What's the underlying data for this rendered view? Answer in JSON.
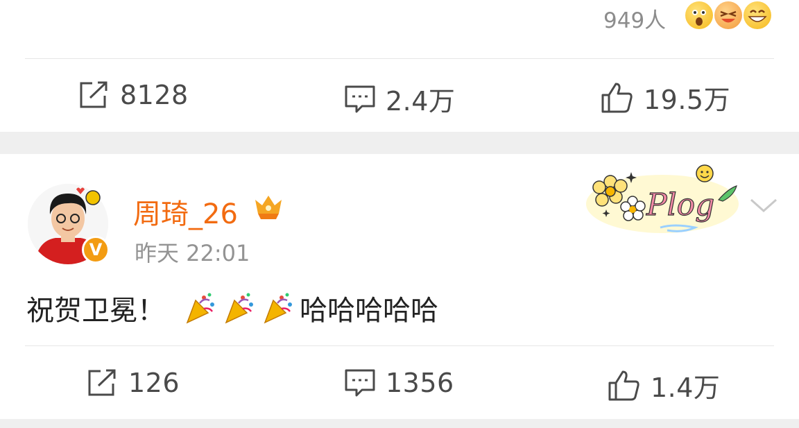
{
  "prev_post": {
    "reaction_count": "949人",
    "reaction_emojis": [
      "surprised-emoji-icon",
      "laughing-emoji-icon",
      "grinning-emoji-icon"
    ],
    "actions": {
      "repost": "8128",
      "comment": "2.4万",
      "like": "19.5万"
    }
  },
  "post": {
    "username": "周琦_26",
    "time": "昨天 22:01",
    "text_before": "祝贺卫冕！",
    "party_emoji_count": 3,
    "text_after": "哈哈哈哈哈",
    "decoration_label": "Plog",
    "verified_badge": "V",
    "actions": {
      "repost": "126",
      "comment": "1356",
      "like": "1.4万"
    }
  },
  "colors": {
    "username": "#f26b11",
    "gray_bg": "#efefef",
    "icon": "#4a4a4a"
  }
}
